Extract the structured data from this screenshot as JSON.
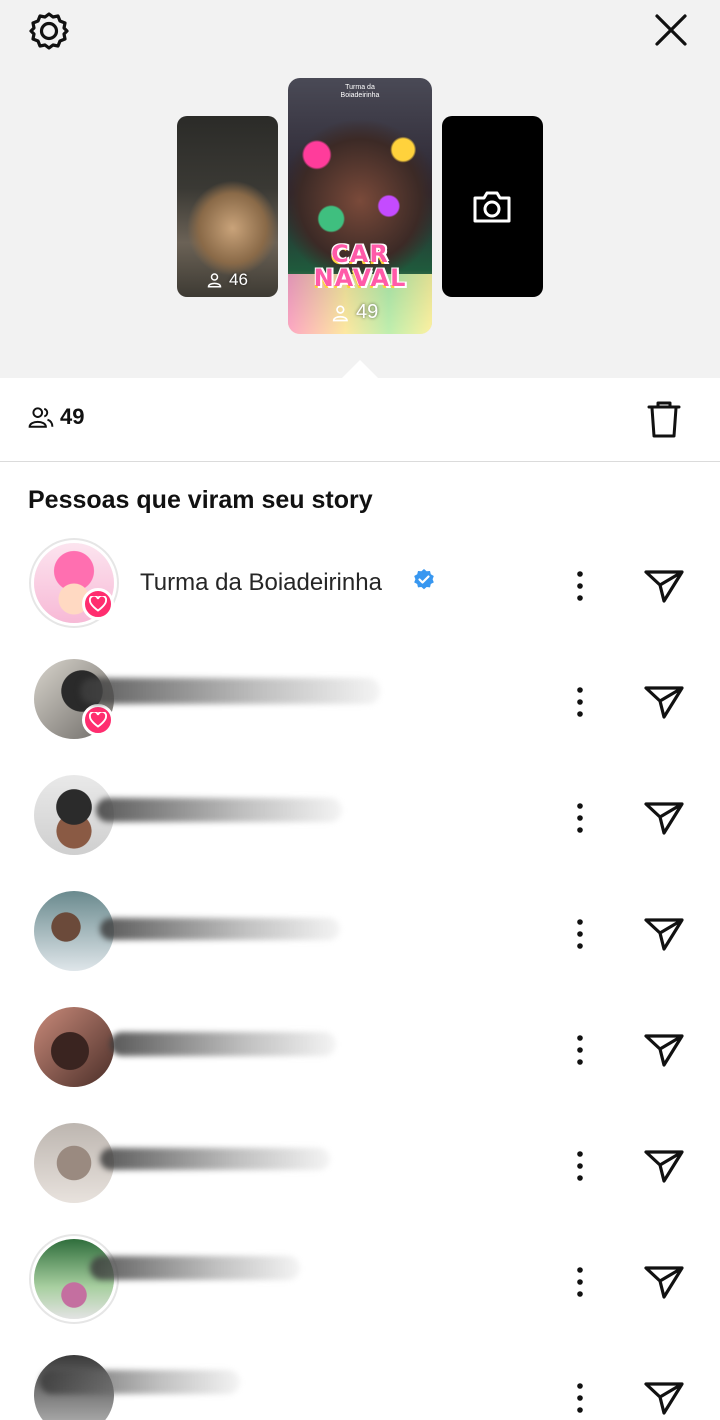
{
  "header": {
    "settings_icon": "gear-icon",
    "close_icon": "close-icon"
  },
  "stories": [
    {
      "views": "46",
      "icon": "viewers-icon"
    },
    {
      "views": "49",
      "sticker_text": "CAR NAVAL",
      "mini_title": "Turma da Boiadeirinha",
      "selected": true
    },
    {
      "icon": "camera-icon"
    }
  ],
  "stats": {
    "viewers_count": "49",
    "delete_icon": "trash-icon"
  },
  "section_title": "Pessoas que viram seu story",
  "viewers": [
    {
      "name": "Turma da Boiadeirinha",
      "verified": true,
      "liked": true
    },
    {
      "name": "",
      "liked": true
    },
    {
      "name": ""
    },
    {
      "name": ""
    },
    {
      "name": ""
    },
    {
      "name": ""
    },
    {
      "name": ""
    },
    {
      "name": ""
    }
  ],
  "colors": {
    "like_badge": "#ff2d6f",
    "verified": "#3897f0",
    "header_bg": "#f2f2f2"
  }
}
